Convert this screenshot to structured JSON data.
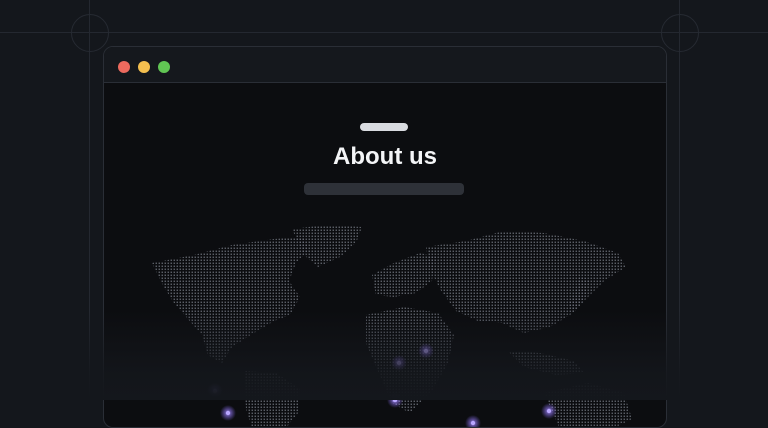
{
  "page": {
    "heading": "About us"
  },
  "colors": {
    "close": "#ec6a5e",
    "minimize": "#f4bf4f",
    "maximize": "#61c554",
    "marker": "#8b6cff"
  },
  "map": {
    "marker_count": 7
  }
}
